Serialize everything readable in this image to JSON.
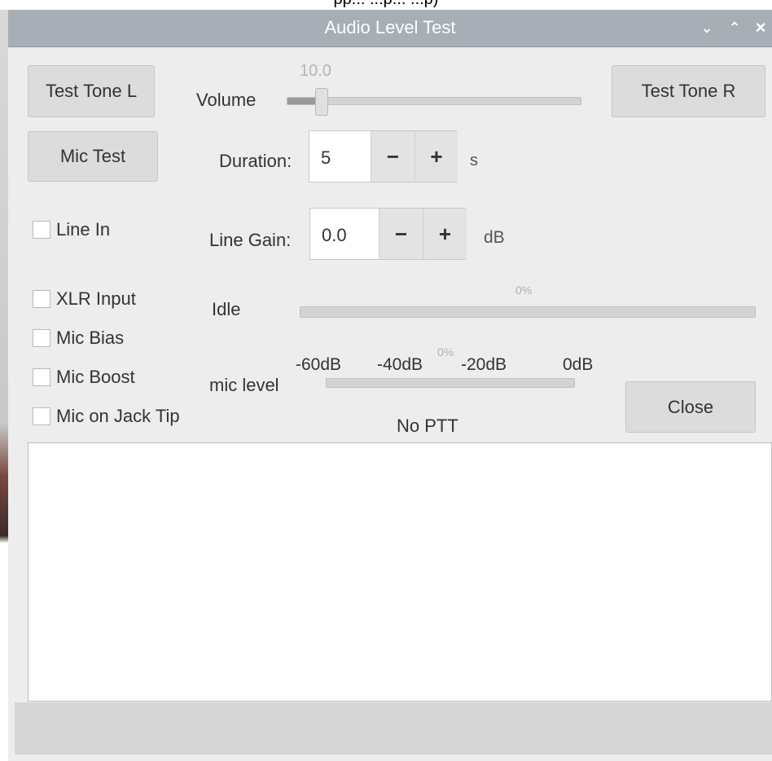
{
  "caption": "pp... ...p... ...p)",
  "window": {
    "title": "Audio Level Test",
    "controls": {
      "minimize_glyph": "⌄",
      "maximize_glyph": "⌃",
      "close_glyph": "×"
    }
  },
  "buttons": {
    "test_tone_l": "Test Tone L",
    "test_tone_r": "Test Tone R",
    "mic_test": "Mic Test",
    "close": "Close"
  },
  "volume": {
    "label": "Volume",
    "value_text": "10.0",
    "value": 10.0,
    "fraction": 0.1
  },
  "duration": {
    "label": "Duration:",
    "value": "5",
    "unit": "s",
    "minus": "−",
    "plus": "+"
  },
  "line_gain": {
    "label": "Line Gain:",
    "value": "0.0",
    "unit": "dB",
    "minus": "−",
    "plus": "+"
  },
  "checkboxes": {
    "line_in": "Line In",
    "xlr_input": "XLR Input",
    "mic_bias": "Mic Bias",
    "mic_boost": "Mic Boost",
    "mic_on_jack_tip": "Mic on Jack Tip"
  },
  "progress": {
    "label": "Idle",
    "percent_text": "0%",
    "fraction": 0.0
  },
  "mic_level": {
    "label": "mic level",
    "scale": [
      "-60dB",
      "-40dB",
      "-20dB",
      "0dB"
    ],
    "percent_text": "0%",
    "fraction": 0.0
  },
  "ptt_status": "No PTT",
  "log_text": ""
}
